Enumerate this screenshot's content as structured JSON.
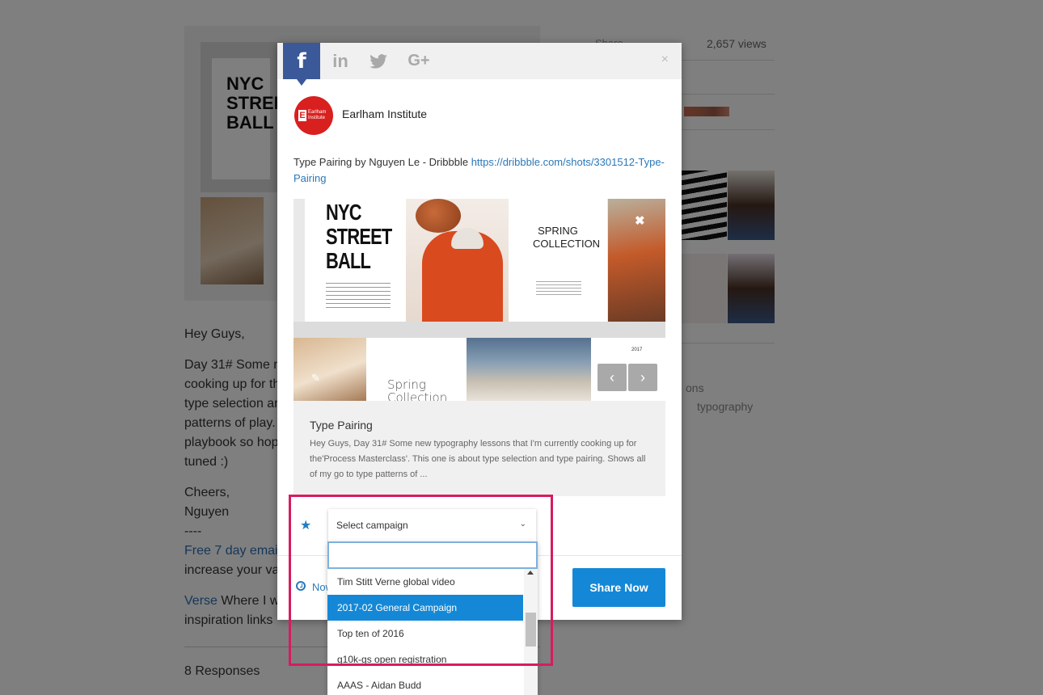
{
  "background": {
    "poster_text": "NYC\nSTREET\nBALL",
    "greeting": "Hey Guys,",
    "body_lines": [
      "Day 31# Some n",
      "cooking up for th",
      "type selection ar",
      "patterns of play.",
      "playbook so hop",
      "tuned :)"
    ],
    "signoff": "Cheers,",
    "author": "Nguyen",
    "dashes": "----",
    "email_link": "Free 7 day emai",
    "email_after": "increase your va",
    "verse_link": "Verse",
    "verse_after": "Where I w",
    "inspiration": "inspiration links",
    "responses": "8 Responses",
    "share_label": "Share",
    "views": "2,657 views",
    "tag_fragment": "ons",
    "tag_typography": "typography"
  },
  "modal": {
    "tabs": [
      {
        "name": "facebook",
        "glyph": "f"
      },
      {
        "name": "linkedin",
        "glyph": "in"
      },
      {
        "name": "twitter",
        "glyph": "🐦"
      },
      {
        "name": "googleplus",
        "glyph": "G+"
      }
    ],
    "close_glyph": "×",
    "page_name": "Earlham Institute",
    "avatar_letter": "E",
    "avatar_text": "Earlham Institute",
    "post_text": "Type Pairing by Nguyen Le - Dribbble ",
    "post_link": "https://dribbble.com/shots/3301512-Type-Pairing",
    "preview": {
      "poster_text": "NYC\nSTREET\nBALL",
      "spring_title": "SPRING\nCOLLECTION",
      "spring_bottom": "Spring\nCollection",
      "page_num": "2017",
      "remove_glyph": "✖",
      "edit_glyph": "✎",
      "prev_glyph": "‹",
      "next_glyph": "›"
    },
    "card": {
      "title": "Type Pairing",
      "description": "Hey Guys, Day 31# Some new typography lessons that I'm currently cooking up for the'Process Masterclass'. This one is about type selection and type pairing. Shows all of my go to type patterns of ..."
    },
    "campaign": {
      "star_glyph": "★",
      "placeholder": "Select campaign",
      "chevron": "⌄",
      "search_value": "",
      "options": [
        "Tim Stitt Verne global video",
        "2017-02 General Campaign",
        "Top ten of 2016",
        "g10k-gs open registration",
        "AAAS - Aidan Budd"
      ],
      "selected_index": 1
    },
    "schedule_label": "Now",
    "share_button": "Share Now"
  },
  "colors": {
    "facebook": "#3b5998",
    "primary": "#1488d6",
    "highlight": "#d81b60",
    "avatar": "#d8201f"
  }
}
